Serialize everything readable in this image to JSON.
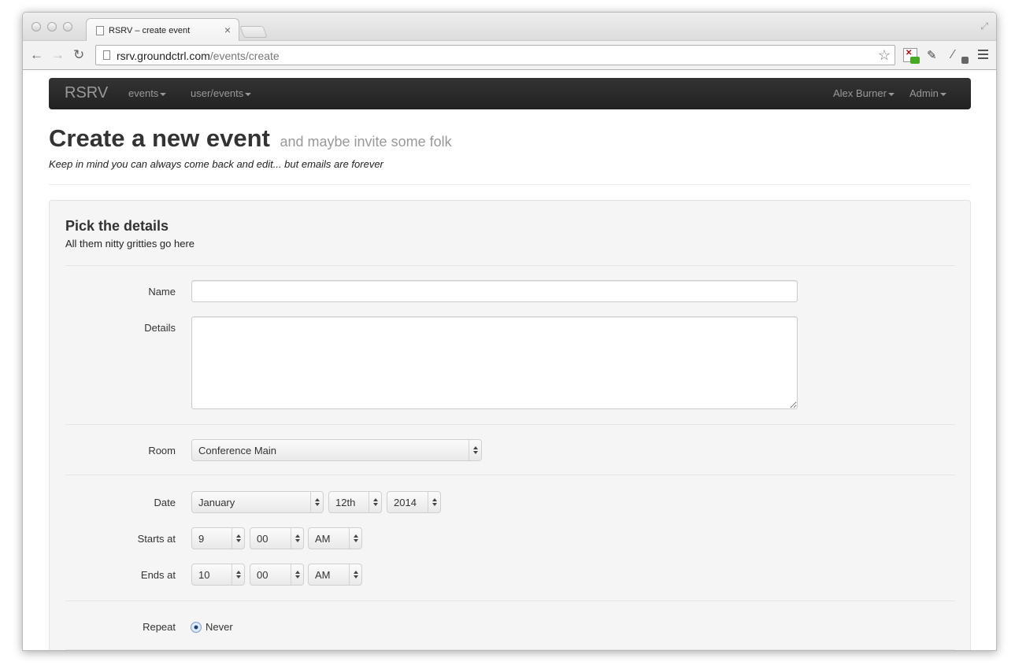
{
  "browser": {
    "tab_title": "RSRV – create event",
    "tab_close": "×",
    "url_host": "rsrv.groundctrl.com",
    "url_path": "/events/create",
    "icons": [
      "back-icon",
      "forward-icon",
      "reload-icon",
      "bookmark-star-icon",
      "extension-icon",
      "evernote-icon",
      "eyedropper-icon",
      "menu-icon"
    ]
  },
  "navbar": {
    "brand": "RSRV",
    "left_items": [
      "events",
      "user/events"
    ],
    "right_items": [
      "Alex Burner",
      "Admin"
    ]
  },
  "header": {
    "title": "Create a new event",
    "subtitle": "and maybe invite some folk",
    "note": "Keep in mind you can always come back and edit... but emails are forever"
  },
  "form": {
    "section_title": "Pick the details",
    "section_subtitle": "All them nitty gritties go here",
    "name_label": "Name",
    "name_value": "",
    "details_label": "Details",
    "details_value": "",
    "room_label": "Room",
    "room_value": "Conference Main",
    "date_label": "Date",
    "date_month": "January",
    "date_day": "12th",
    "date_year": "2014",
    "starts_label": "Starts at",
    "starts_hour": "9",
    "starts_minute": "00",
    "starts_ampm": "AM",
    "ends_label": "Ends at",
    "ends_hour": "10",
    "ends_minute": "00",
    "ends_ampm": "AM",
    "repeat_label": "Repeat",
    "repeat_option": "Never"
  }
}
